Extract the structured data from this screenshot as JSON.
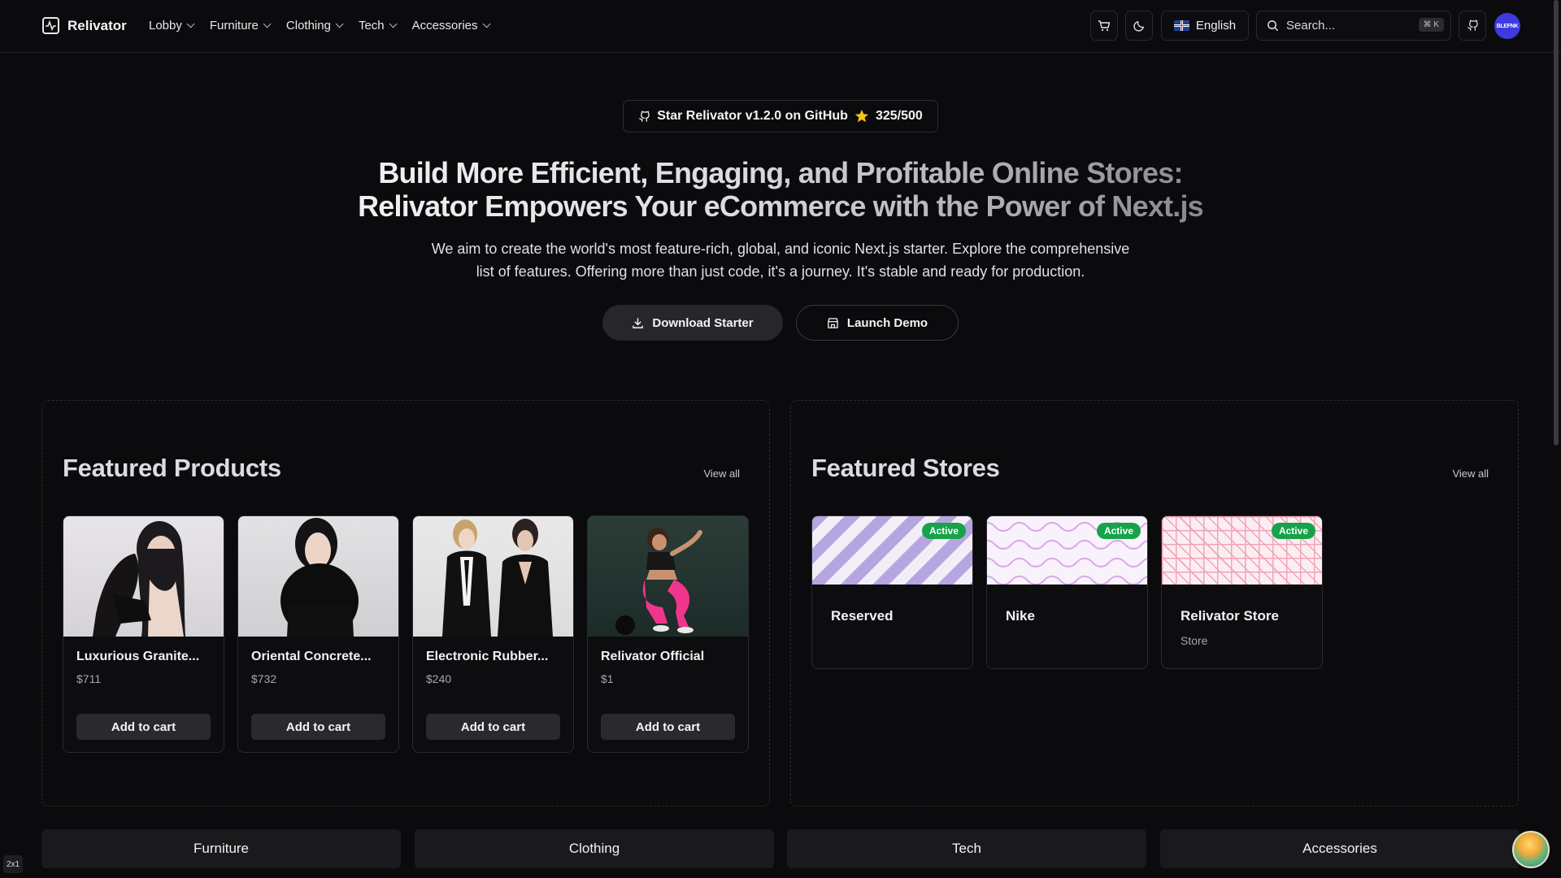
{
  "header": {
    "brand": "Relivator",
    "nav": [
      "Lobby",
      "Furniture",
      "Clothing",
      "Tech",
      "Accessories"
    ],
    "language": "English",
    "search_placeholder": "Search...",
    "search_shortcut": "⌘ K",
    "avatar_text": "BLEFNK"
  },
  "hero": {
    "github_pill": "Star Relivator v1.2.0 on GitHub",
    "github_stars": "325/500",
    "title_line1": "Build More Efficient, Engaging, and Profitable Online Stores:",
    "title_line2": "Relivator Empowers Your eCommerce with the Power of Next.js",
    "subtitle_line1": "We aim to create the world's most feature-rich, global, and iconic Next.js starter. Explore the comprehensive",
    "subtitle_line2": "list of features. Offering more than just code, it's a journey. It's stable and ready for production.",
    "primary_cta": "Download Starter",
    "secondary_cta": "Launch Demo"
  },
  "featured_products": {
    "title": "Featured Products",
    "view_all": "View all",
    "items": [
      {
        "name": "Luxurious Granite...",
        "price": "$711",
        "button": "Add to cart"
      },
      {
        "name": "Oriental Concrete...",
        "price": "$732",
        "button": "Add to cart"
      },
      {
        "name": "Electronic Rubber...",
        "price": "$240",
        "button": "Add to cart"
      },
      {
        "name": "Relivator Official",
        "price": "$1",
        "button": "Add to cart"
      }
    ]
  },
  "featured_stores": {
    "title": "Featured Stores",
    "view_all": "View all",
    "items": [
      {
        "name": "Reserved",
        "status": "Active",
        "type": ""
      },
      {
        "name": "Nike",
        "status": "Active",
        "type": ""
      },
      {
        "name": "Relivator Store",
        "status": "Active",
        "type": "Store"
      }
    ]
  },
  "categories": [
    "Furniture",
    "Clothing",
    "Tech",
    "Accessories"
  ],
  "dev_badge": "2x1",
  "colors": {
    "background": "#0b0b0d",
    "active_badge": "#16a34a",
    "avatar": "#3d3ae0",
    "store1_stripe": "#b6a6e0",
    "store2_wave": "#d9a8e8",
    "store3_grid": "#f2a4b8"
  }
}
